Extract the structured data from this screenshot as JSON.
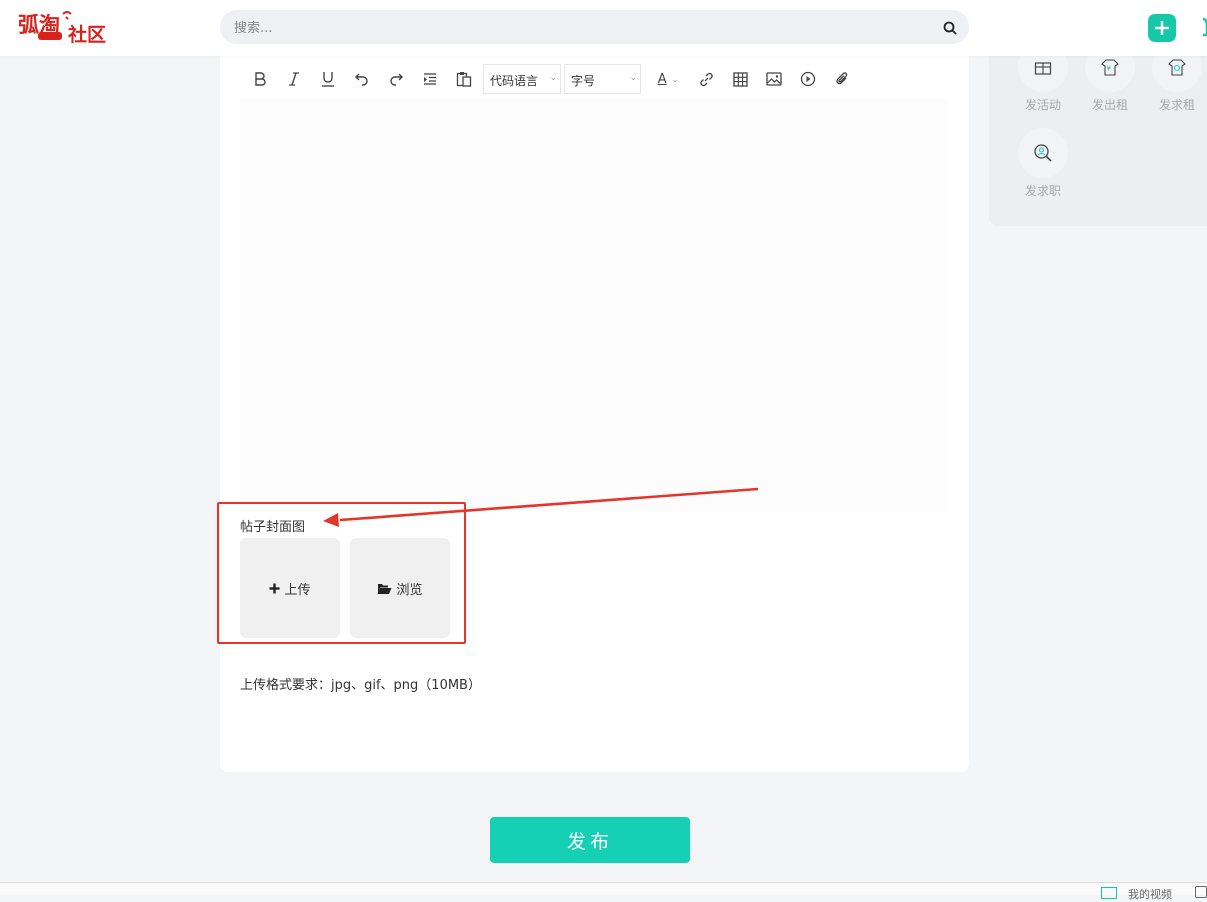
{
  "header": {
    "logo_text_main": "弧淘",
    "logo_text_sub": "社区",
    "search_placeholder": "搜索..."
  },
  "toolbar": {
    "code_language_label": "代码语言",
    "font_size_label": "字号",
    "font_color_label": "A",
    "icons": [
      "bold-icon",
      "italic-icon",
      "underline-icon",
      "undo-icon",
      "redo-icon",
      "indent-icon",
      "paste-icon",
      "font-color-icon",
      "link-icon",
      "table-icon",
      "image-icon",
      "video-icon",
      "attachment-icon"
    ]
  },
  "editor": {
    "content": ""
  },
  "cover": {
    "label": "帖子封面图",
    "upload_label": "上传",
    "browse_label": "浏览"
  },
  "format_note": "上传格式要求：jpg、gif、png（10MB）",
  "quick_actions": [
    {
      "label": "发活动",
      "icon": "activity-icon"
    },
    {
      "label": "发出租",
      "icon": "rent-out-icon"
    },
    {
      "label": "发求租",
      "icon": "seek-rent-icon"
    },
    {
      "label": "发求职",
      "icon": "job-search-icon"
    }
  ],
  "publish_label": "发布",
  "bottom_bar": {
    "text": "我的视频"
  },
  "colors": {
    "accent": "#16d0b4",
    "highlight": "#e5352b",
    "logo_red": "#d9221c"
  }
}
